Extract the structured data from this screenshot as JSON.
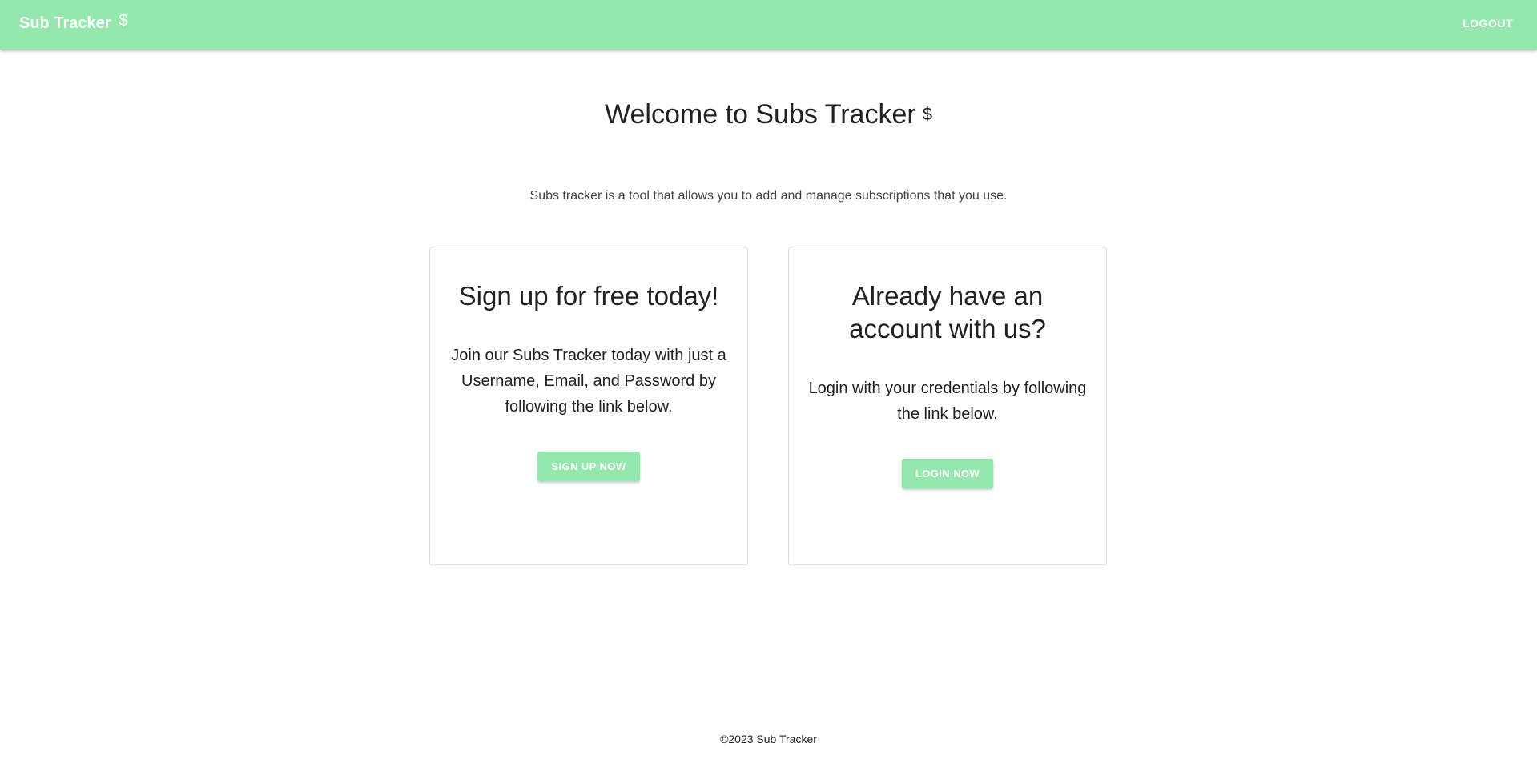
{
  "header": {
    "brand": "Sub Tracker",
    "brand_icon": "$",
    "logout_label": "LOGOUT"
  },
  "main": {
    "title": "Welcome to Subs Tracker",
    "title_icon": "$",
    "subtitle": "Subs tracker is a tool that allows you to add and manage subscriptions that you use."
  },
  "cards": [
    {
      "title": "Sign up for free today!",
      "text": "Join our Subs Tracker today with just a Username, Email, and Password by following the link below.",
      "button_label": "SIGN UP NOW"
    },
    {
      "title": "Already have an account with us?",
      "text": "Login with your credentials by following the link below.",
      "button_label": "LOGIN NOW"
    }
  ],
  "footer": {
    "text": "©2023 Sub Tracker"
  },
  "colors": {
    "accent": "#95e8ad",
    "text": "#212121"
  },
  "icons": {
    "brand_icon": "dollar-icon",
    "title_icon": "dollar-icon"
  }
}
